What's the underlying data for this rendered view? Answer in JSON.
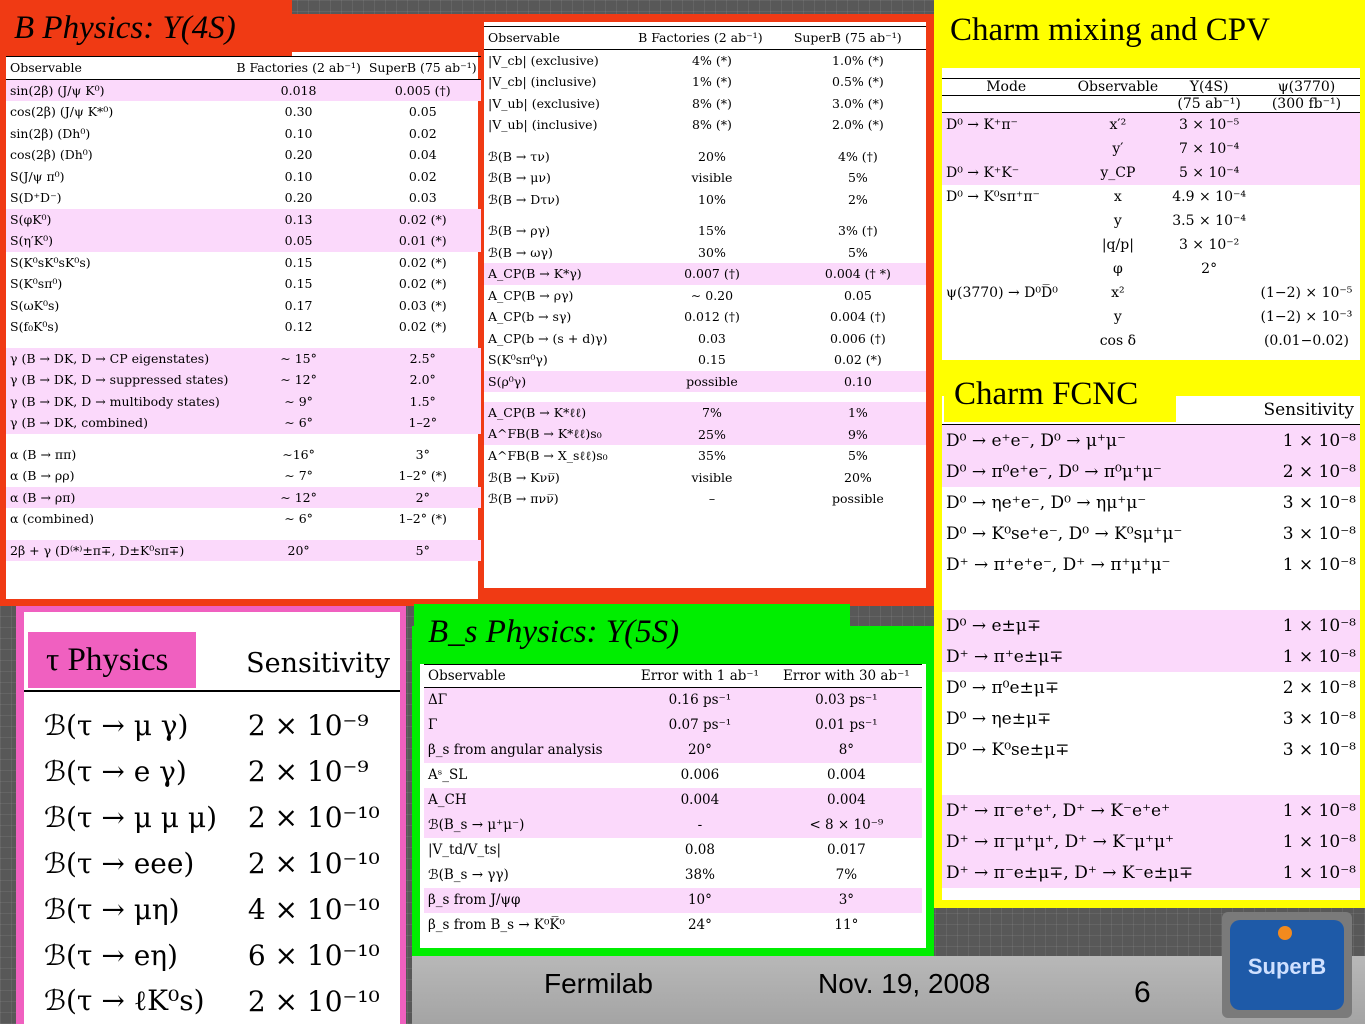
{
  "b4s": {
    "title": "B Physics:  Y(4S)",
    "headers": [
      "Observable",
      "B Factories (2 ab⁻¹)",
      "SuperB (75 ab⁻¹)"
    ],
    "rows": [
      {
        "obs": "sin(2β) (J/ψ K⁰)",
        "bf": "0.018",
        "sb": "0.005 (†)",
        "hl": true
      },
      {
        "obs": "cos(2β) (J/ψ K*⁰)",
        "bf": "0.30",
        "sb": "0.05",
        "hl": false
      },
      {
        "obs": "sin(2β) (Dh⁰)",
        "bf": "0.10",
        "sb": "0.02",
        "hl": false
      },
      {
        "obs": "cos(2β) (Dh⁰)",
        "bf": "0.20",
        "sb": "0.04",
        "hl": false
      },
      {
        "obs": "S(J/ψ π⁰)",
        "bf": "0.10",
        "sb": "0.02",
        "hl": false
      },
      {
        "obs": "S(D⁺D⁻)",
        "bf": "0.20",
        "sb": "0.03",
        "hl": false
      },
      {
        "obs": "S(φK⁰)",
        "bf": "0.13",
        "sb": "0.02 (*)",
        "hl": true
      },
      {
        "obs": "S(η′K⁰)",
        "bf": "0.05",
        "sb": "0.01 (*)",
        "hl": true
      },
      {
        "obs": "S(K⁰sK⁰sK⁰s)",
        "bf": "0.15",
        "sb": "0.02 (*)",
        "hl": false
      },
      {
        "obs": "S(K⁰sπ⁰)",
        "bf": "0.15",
        "sb": "0.02 (*)",
        "hl": false
      },
      {
        "obs": "S(ωK⁰s)",
        "bf": "0.17",
        "sb": "0.03 (*)",
        "hl": false
      },
      {
        "obs": "S(f₀K⁰s)",
        "bf": "0.12",
        "sb": "0.02 (*)",
        "hl": false
      },
      {
        "gap": true
      },
      {
        "obs": "γ (B → DK, D → CP eigenstates)",
        "bf": "∼ 15°",
        "sb": "2.5°",
        "hl": true
      },
      {
        "obs": "γ (B → DK, D → suppressed states)",
        "bf": "∼ 12°",
        "sb": "2.0°",
        "hl": true
      },
      {
        "obs": "γ (B → DK, D → multibody states)",
        "bf": "∼ 9°",
        "sb": "1.5°",
        "hl": true
      },
      {
        "obs": "γ (B → DK, combined)",
        "bf": "∼ 6°",
        "sb": "1–2°",
        "hl": true
      },
      {
        "gap": true
      },
      {
        "obs": "α (B → ππ)",
        "bf": "∼16°",
        "sb": "3°",
        "hl": false
      },
      {
        "obs": "α (B → ρρ)",
        "bf": "∼ 7°",
        "sb": "1–2° (*)",
        "hl": false
      },
      {
        "obs": "α (B → ρπ)",
        "bf": "∼ 12°",
        "sb": "2°",
        "hl": true
      },
      {
        "obs": "α (combined)",
        "bf": "∼ 6°",
        "sb": "1–2° (*)",
        "hl": false
      },
      {
        "gap": true
      },
      {
        "obs": "2β + γ (D⁽*⁾±π∓, D±K⁰sπ∓)",
        "bf": "20°",
        "sb": "5°",
        "hl": true
      }
    ]
  },
  "b4s_right": {
    "headers": [
      "Observable",
      "B Factories (2 ab⁻¹)",
      "SuperB (75 ab⁻¹)"
    ],
    "rows": [
      {
        "obs": "|V_cb| (exclusive)",
        "bf": "4% (*)",
        "sb": "1.0% (*)",
        "hl": false
      },
      {
        "obs": "|V_cb| (inclusive)",
        "bf": "1% (*)",
        "sb": "0.5% (*)",
        "hl": false
      },
      {
        "obs": "|V_ub| (exclusive)",
        "bf": "8% (*)",
        "sb": "3.0% (*)",
        "hl": false
      },
      {
        "obs": "|V_ub| (inclusive)",
        "bf": "8% (*)",
        "sb": "2.0% (*)",
        "hl": false
      },
      {
        "gap": true
      },
      {
        "obs": "ℬ(B → τν)",
        "bf": "20%",
        "sb": "4% (†)",
        "hl": false
      },
      {
        "obs": "ℬ(B → μν)",
        "bf": "visible",
        "sb": "5%",
        "hl": false
      },
      {
        "obs": "ℬ(B → Dτν)",
        "bf": "10%",
        "sb": "2%",
        "hl": false
      },
      {
        "gap": true
      },
      {
        "obs": "ℬ(B → ργ)",
        "bf": "15%",
        "sb": "3% (†)",
        "hl": false
      },
      {
        "obs": "ℬ(B → ωγ)",
        "bf": "30%",
        "sb": "5%",
        "hl": false
      },
      {
        "obs": "A_CP(B → K*γ)",
        "bf": "0.007 (†)",
        "sb": "0.004 († *)",
        "hl": true
      },
      {
        "obs": "A_CP(B → ργ)",
        "bf": "∼ 0.20",
        "sb": "0.05",
        "hl": false
      },
      {
        "obs": "A_CP(b → sγ)",
        "bf": "0.012 (†)",
        "sb": "0.004 (†)",
        "hl": false
      },
      {
        "obs": "A_CP(b → (s + d)γ)",
        "bf": "0.03",
        "sb": "0.006 (†)",
        "hl": false
      },
      {
        "obs": "S(K⁰sπ⁰γ)",
        "bf": "0.15",
        "sb": "0.02 (*)",
        "hl": false
      },
      {
        "obs": "S(ρ⁰γ)",
        "bf": "possible",
        "sb": "0.10",
        "hl": true
      },
      {
        "gap": true
      },
      {
        "obs": "A_CP(B → K*ℓℓ)",
        "bf": "7%",
        "sb": "1%",
        "hl": true
      },
      {
        "obs": "A^FB(B → K*ℓℓ)s₀",
        "bf": "25%",
        "sb": "9%",
        "hl": true
      },
      {
        "obs": "A^FB(B → X_sℓℓ)s₀",
        "bf": "35%",
        "sb": "5%",
        "hl": false
      },
      {
        "obs": "ℬ(B → Kνν̅)",
        "bf": "visible",
        "sb": "20%",
        "hl": false
      },
      {
        "obs": "ℬ(B → πνν̅)",
        "bf": "–",
        "sb": "possible",
        "hl": false
      }
    ]
  },
  "charm_mix": {
    "title": "Charm mixing and CPV",
    "headers": [
      "Mode",
      "Observable",
      "Υ(4S)",
      "ψ(3770)"
    ],
    "subheaders": [
      "",
      "",
      "(75 ab⁻¹)",
      "(300 fb⁻¹)"
    ],
    "rows": [
      {
        "mode": "D⁰ → K⁺π⁻",
        "obs": "x′²",
        "y4s": "3 × 10⁻⁵",
        "psi": "",
        "hl": true
      },
      {
        "mode": "",
        "obs": "y′",
        "y4s": "7 × 10⁻⁴",
        "psi": "",
        "hl": true
      },
      {
        "mode": "D⁰ → K⁺K⁻",
        "obs": "y_CP",
        "y4s": "5 × 10⁻⁴",
        "psi": "",
        "hl": true
      },
      {
        "mode": "D⁰ → K⁰sπ⁺π⁻",
        "obs": "x",
        "y4s": "4.9 × 10⁻⁴",
        "psi": "",
        "hl": false
      },
      {
        "mode": "",
        "obs": "y",
        "y4s": "3.5 × 10⁻⁴",
        "psi": "",
        "hl": false
      },
      {
        "mode": "",
        "obs": "|q/p|",
        "y4s": "3 × 10⁻²",
        "psi": "",
        "hl": false
      },
      {
        "mode": "",
        "obs": "φ",
        "y4s": "2°",
        "psi": "",
        "hl": false
      },
      {
        "mode": "ψ(3770) → D⁰D̅⁰",
        "obs": "x²",
        "y4s": "",
        "psi": "(1−2) × 10⁻⁵",
        "hl": false
      },
      {
        "mode": "",
        "obs": "y",
        "y4s": "",
        "psi": "(1−2) × 10⁻³",
        "hl": false
      },
      {
        "mode": "",
        "obs": "cos δ",
        "y4s": "",
        "psi": "(0.01−0.02)",
        "hl": false
      }
    ]
  },
  "charm_fcnc": {
    "title": "Charm FCNC",
    "header": "Sensitivity",
    "rows": [
      {
        "mode": "D⁰ → e⁺e⁻, D⁰ → μ⁺μ⁻",
        "s": "1 × 10⁻⁸",
        "hl": true
      },
      {
        "mode": "D⁰ → π⁰e⁺e⁻, D⁰ → π⁰μ⁺μ⁻",
        "s": "2 × 10⁻⁸",
        "hl": true
      },
      {
        "mode": "D⁰ → ηe⁺e⁻, D⁰ → ημ⁺μ⁻",
        "s": "3 × 10⁻⁸",
        "hl": false
      },
      {
        "mode": "D⁰ → K⁰se⁺e⁻, D⁰ → K⁰sμ⁺μ⁻",
        "s": "3 × 10⁻⁸",
        "hl": false
      },
      {
        "mode": "D⁺ → π⁺e⁺e⁻, D⁺ → π⁺μ⁺μ⁻",
        "s": "1 × 10⁻⁸",
        "hl": false
      },
      {
        "gap": true
      },
      {
        "mode": "D⁰ → e±μ∓",
        "s": "1 × 10⁻⁸",
        "hl": true
      },
      {
        "mode": "D⁺ → π⁺e±μ∓",
        "s": "1 × 10⁻⁸",
        "hl": true
      },
      {
        "mode": "D⁰ → π⁰e±μ∓",
        "s": "2 × 10⁻⁸",
        "hl": false
      },
      {
        "mode": "D⁰ → ηe±μ∓",
        "s": "3 × 10⁻⁸",
        "hl": false
      },
      {
        "mode": "D⁰ → K⁰se±μ∓",
        "s": "3 × 10⁻⁸",
        "hl": false
      },
      {
        "gap": true
      },
      {
        "mode": "D⁺ → π⁻e⁺e⁺, D⁺ → K⁻e⁺e⁺",
        "s": "1 × 10⁻⁸",
        "hl": true
      },
      {
        "mode": "D⁺ → π⁻μ⁺μ⁺, D⁺ → K⁻μ⁺μ⁺",
        "s": "1 × 10⁻⁸",
        "hl": true
      },
      {
        "mode": "D⁺ → π⁻e±μ∓, D⁺ → K⁻e±μ∓",
        "s": "1 × 10⁻⁸",
        "hl": true
      }
    ]
  },
  "tau": {
    "title": "τ Physics",
    "header": "Sensitivity",
    "rows": [
      {
        "mode": "ℬ(τ → μ γ)",
        "s": "2 × 10⁻⁹"
      },
      {
        "mode": "ℬ(τ → e γ)",
        "s": "2 × 10⁻⁹"
      },
      {
        "mode": "ℬ(τ → μ μ μ)",
        "s": "2 × 10⁻¹⁰"
      },
      {
        "mode": "ℬ(τ → eee)",
        "s": "2 × 10⁻¹⁰"
      },
      {
        "mode": "ℬ(τ → μη)",
        "s": "4 × 10⁻¹⁰"
      },
      {
        "mode": "ℬ(τ → eη)",
        "s": "6 × 10⁻¹⁰"
      },
      {
        "mode": "ℬ(τ → ℓK⁰s)",
        "s": "2 × 10⁻¹⁰"
      }
    ]
  },
  "bs5s": {
    "title": "B_s Physics:  Y(5S)",
    "headers": [
      "Observable",
      "Error with 1 ab⁻¹",
      "Error with 30 ab⁻¹"
    ],
    "rows": [
      {
        "obs": "ΔΓ",
        "e1": "0.16 ps⁻¹",
        "e30": "0.03 ps⁻¹",
        "hl": true
      },
      {
        "obs": "Γ",
        "e1": "0.07 ps⁻¹",
        "e30": "0.01 ps⁻¹",
        "hl": true
      },
      {
        "obs": "β_s from angular analysis",
        "e1": "20°",
        "e30": "8°",
        "hl": true
      },
      {
        "obs": "Aˢ_SL",
        "e1": "0.006",
        "e30": "0.004",
        "hl": false
      },
      {
        "obs": "A_CH",
        "e1": "0.004",
        "e30": "0.004",
        "hl": true
      },
      {
        "obs": "ℬ(B_s → μ⁺μ⁻)",
        "e1": "-",
        "e30": "< 8 × 10⁻⁹",
        "hl": true
      },
      {
        "obs": "|V_td/V_ts|",
        "e1": "0.08",
        "e30": "0.017",
        "hl": false
      },
      {
        "obs": "ℬ(B_s → γγ)",
        "e1": "38%",
        "e30": "7%",
        "hl": false
      },
      {
        "obs": "β_s from J/ψφ",
        "e1": "10°",
        "e30": "3°",
        "hl": true
      },
      {
        "obs": "β_s from B_s → K⁰K̅⁰",
        "e1": "24°",
        "e30": "11°",
        "hl": false
      }
    ]
  },
  "footer": {
    "venue": "Fermilab",
    "date": "Nov. 19, 2008",
    "page": "6",
    "logo_text": "SuperB"
  },
  "colors": {
    "b4s_frame": "#f03a14",
    "charm_frame": "#ffff00",
    "tau_frame": "#f060c0",
    "bs5s_frame": "#00ee00",
    "highlight": "#fbd9fb",
    "logo_blue": "#1e5aa8"
  }
}
